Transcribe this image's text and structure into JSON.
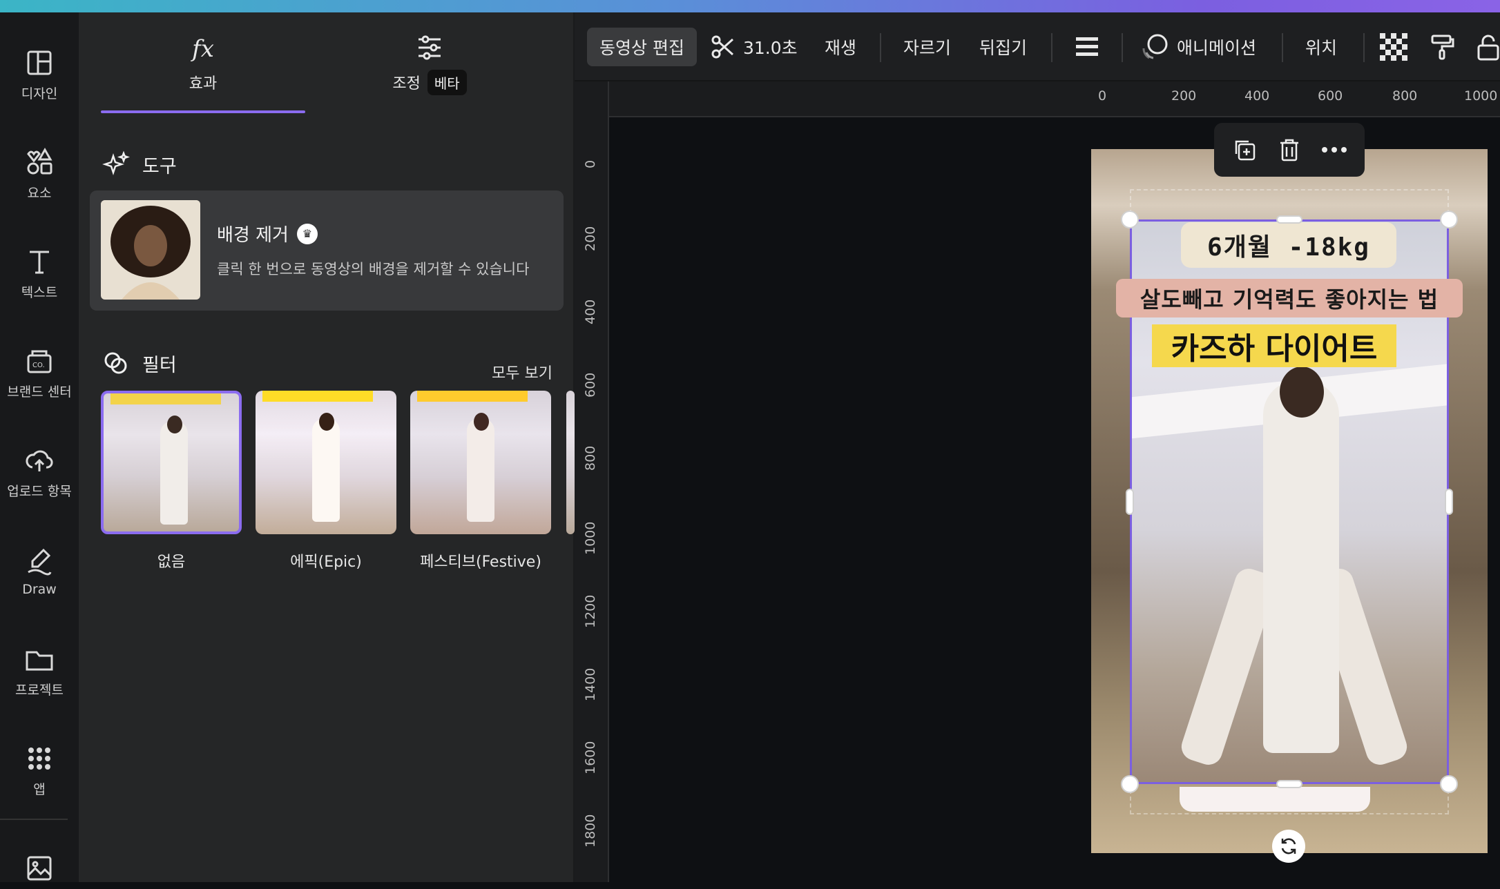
{
  "left_rail": {
    "items": [
      {
        "label": "디자인",
        "icon": "layout-icon"
      },
      {
        "label": "요소",
        "icon": "shapes-icon"
      },
      {
        "label": "텍스트",
        "icon": "text-icon"
      },
      {
        "label": "브랜드 센터",
        "icon": "brand-icon"
      },
      {
        "label": "업로드 항목",
        "icon": "upload-icon"
      },
      {
        "label": "Draw",
        "icon": "draw-icon"
      },
      {
        "label": "프로젝트",
        "icon": "folder-icon"
      },
      {
        "label": "앱",
        "icon": "apps-grid-icon"
      }
    ]
  },
  "panel": {
    "tabs": [
      {
        "label": "효과",
        "icon": "fx-icon",
        "active": true
      },
      {
        "label": "조정",
        "badge": "베타",
        "icon": "sliders-icon",
        "active": false
      }
    ],
    "tools_heading": "도구",
    "bg_remove": {
      "title": "배경 제거",
      "description": "클릭 한 번으로 동영상의 배경을 제거할 수 있습니다"
    },
    "filters_heading": "필터",
    "see_all": "모두 보기",
    "filters": [
      {
        "label": "없음",
        "selected": true
      },
      {
        "label": "에픽(Epic)",
        "selected": false
      },
      {
        "label": "페스티브(Festive)",
        "selected": false
      }
    ]
  },
  "toolbar": {
    "edit_video": "동영상 편집",
    "duration": "31.0초",
    "play": "재생",
    "crop": "자르기",
    "flip": "뒤집기",
    "animation": "애니메이션",
    "position": "위치"
  },
  "rulers": {
    "top": [
      "0",
      "200",
      "400",
      "600",
      "800",
      "1000"
    ],
    "left": [
      "0",
      "200",
      "400",
      "600",
      "800",
      "1000",
      "1200",
      "1400",
      "1600",
      "1800"
    ]
  },
  "video_text": {
    "line1": "6개월 -18kg",
    "line2": "살도빼고 기억력도 좋아지는 법",
    "line3": "카즈하 다이어트"
  },
  "colors": {
    "accent": "#8b6cf0",
    "panel_bg": "#252627",
    "rail_bg": "#18191b",
    "highlight_yellow": "#f5d84d"
  }
}
